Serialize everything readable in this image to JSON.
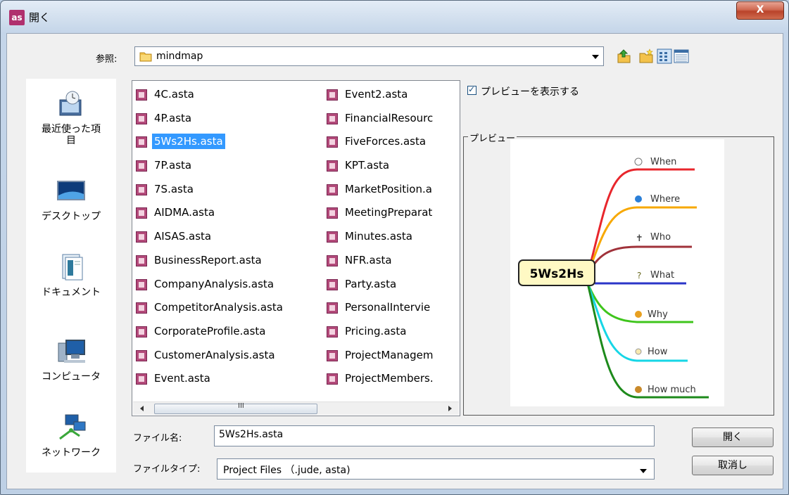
{
  "window": {
    "title": "開く",
    "app_icon": "astah-icon",
    "close_label": "X"
  },
  "look_in": {
    "label": "参照:",
    "value": "mindmap",
    "icon": "folder-icon"
  },
  "toolbar": [
    "up-folder-icon",
    "new-folder-icon",
    "list-view-icon",
    "details-view-icon"
  ],
  "places": [
    {
      "label": "最近使った項\n目",
      "icon": "recent-items-icon"
    },
    {
      "label": "デスクトップ",
      "icon": "desktop-icon"
    },
    {
      "label": "ドキュメント",
      "icon": "documents-icon"
    },
    {
      "label": "コンピュータ",
      "icon": "computer-icon"
    },
    {
      "label": "ネットワーク",
      "icon": "network-icon"
    }
  ],
  "files_col1": [
    "4C.asta",
    "4P.asta",
    "5Ws2Hs.asta",
    "7P.asta",
    "7S.asta",
    "AIDMA.asta",
    "AISAS.asta",
    "BusinessReport.asta",
    "CompanyAnalysis.asta",
    "CompetitorAnalysis.asta",
    "CorporateProfile.asta",
    "CustomerAnalysis.asta",
    "Event.asta"
  ],
  "files_col2": [
    "Event2.asta",
    "FinancialResourc",
    "FiveForces.asta",
    "KPT.asta",
    "MarketPosition.a",
    "MeetingPreparat",
    "Minutes.asta",
    "NFR.asta",
    "Party.asta",
    "PersonalIntervie",
    "Pricing.asta",
    "ProjectManagem",
    "ProjectMembers."
  ],
  "selected_file": "5Ws2Hs.asta",
  "scrollbar": {
    "grip": "III"
  },
  "preview_toggle": {
    "label": "プレビューを表示する",
    "checked": true
  },
  "preview": {
    "group_label": "プレビュー",
    "center": "5Ws2Hs",
    "branches": [
      {
        "label": "When",
        "color": "#e8262c"
      },
      {
        "label": "Where",
        "color": "#f7a800"
      },
      {
        "label": "Who",
        "color": "#a0323a"
      },
      {
        "label": "What",
        "color": "#2b36c8"
      },
      {
        "label": "Why",
        "color": "#3fc51c"
      },
      {
        "label": "How",
        "color": "#16d6e6"
      },
      {
        "label": "How much",
        "color": "#1d8a1b"
      }
    ]
  },
  "filename": {
    "label": "ファイル名:",
    "value": "5Ws2Hs.asta"
  },
  "filetype": {
    "label": "ファイルタイプ:",
    "value": "Project Files （.jude, asta)"
  },
  "buttons": {
    "open": "開く",
    "cancel": "取消し"
  }
}
